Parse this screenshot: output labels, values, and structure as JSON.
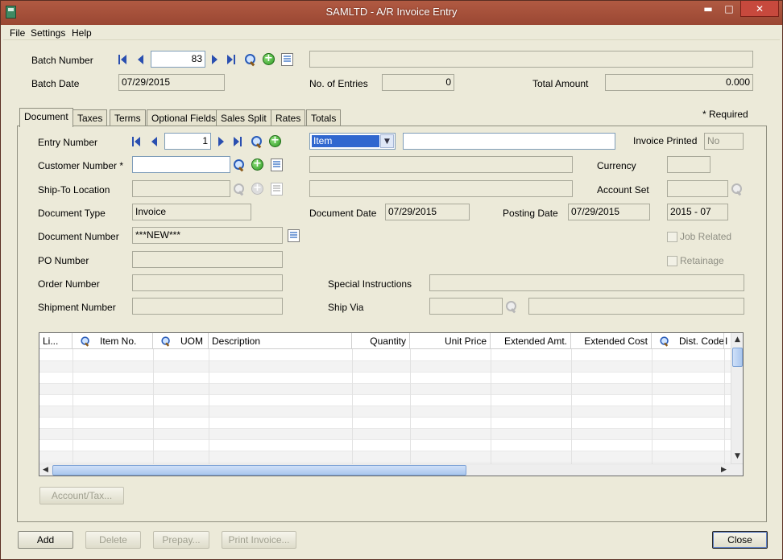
{
  "window": {
    "title": "SAMLTD - A/R Invoice Entry",
    "minimize": "▬",
    "maximize": "□",
    "close": "✕"
  },
  "menu": {
    "file": "File",
    "settings": "Settings",
    "help": "Help"
  },
  "header": {
    "batch_number_label": "Batch Number",
    "batch_number": "83",
    "batch_description": "",
    "batch_date_label": "Batch Date",
    "batch_date": "07/29/2015",
    "entries_label": "No. of Entries",
    "entries": "0",
    "total_label": "Total Amount",
    "total": "0.000"
  },
  "required_note": "*  Required",
  "tabs": [
    {
      "label": "Document"
    },
    {
      "label": "Taxes"
    },
    {
      "label": "Terms"
    },
    {
      "label": "Optional Fields"
    },
    {
      "label": "Sales Split"
    },
    {
      "label": "Rates"
    },
    {
      "label": "Totals"
    }
  ],
  "document": {
    "entry_number_label": "Entry Number",
    "entry_number": "1",
    "entry_type": "Item",
    "entry_description": "",
    "invoice_printed_label": "Invoice Printed",
    "invoice_printed": "No",
    "customer_number_label": "Customer Number *",
    "customer_number": "",
    "customer_name": "",
    "currency_label": "Currency",
    "currency": "",
    "ship_to_label": "Ship-To Location",
    "ship_to": "",
    "ship_to_description": "",
    "account_set_label": "Account Set",
    "account_set": "",
    "doc_type_label": "Document Type",
    "doc_type": "Invoice",
    "doc_date_label": "Document Date",
    "doc_date": "07/29/2015",
    "posting_date_label": "Posting Date",
    "posting_date": "07/29/2015",
    "fiscal_period": "2015 - 07",
    "doc_number_label": "Document Number",
    "doc_number": "***NEW***",
    "job_related_label": "Job Related",
    "po_number_label": "PO Number",
    "po_number": "",
    "retainage_label": "Retainage",
    "order_number_label": "Order Number",
    "order_number": "",
    "special_instr_label": "Special Instructions",
    "special_instr": "",
    "shipment_number_label": "Shipment Number",
    "shipment_number": "",
    "ship_via_label": "Ship Via",
    "ship_via": "",
    "ship_via_description": ""
  },
  "grid": {
    "columns": [
      "Li...",
      "Item No.",
      "UOM",
      "Description",
      "Quantity",
      "Unit Price",
      "Extended Amt.",
      "Extended Cost",
      "Dist. Code",
      "I"
    ]
  },
  "buttons": {
    "account_tax": "Account/Tax...",
    "add": "Add",
    "delete": "Delete",
    "prepay": "Prepay...",
    "print_invoice": "Print Invoice...",
    "close": "Close"
  }
}
